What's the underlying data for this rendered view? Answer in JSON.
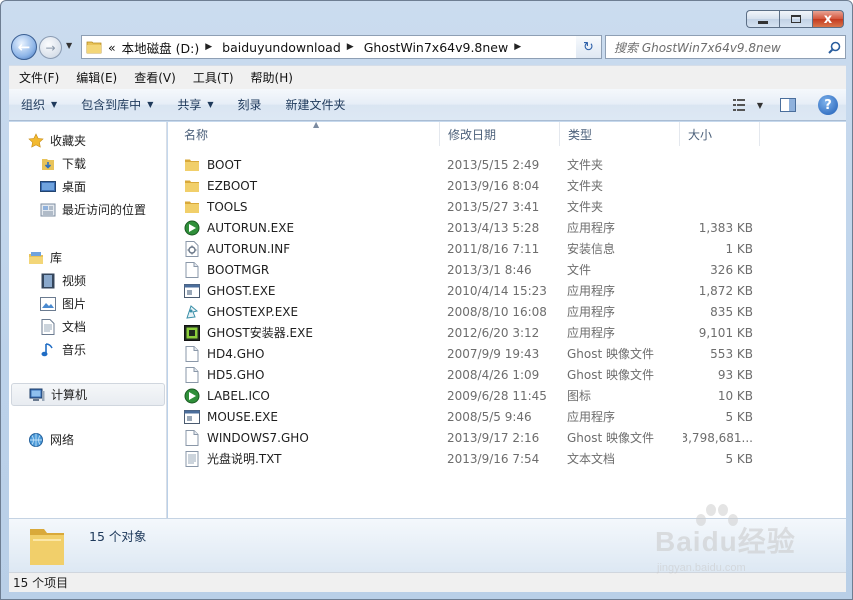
{
  "window": {
    "minimize_label": "",
    "maximize_label": "",
    "close_label": "x"
  },
  "nav": {
    "breadcrumbs": [
      "本地磁盘 (D:)",
      "baiduyundownload",
      "GhostWin7x64v9.8new"
    ],
    "overflow": "«",
    "search_placeholder": "搜索 GhostWin7x64v9.8new"
  },
  "menubar": [
    "文件(F)",
    "编辑(E)",
    "查看(V)",
    "工具(T)",
    "帮助(H)"
  ],
  "commands": [
    {
      "label": "组织",
      "dropdown": true
    },
    {
      "label": "包含到库中",
      "dropdown": true
    },
    {
      "label": "共享",
      "dropdown": true
    },
    {
      "label": "刻录",
      "dropdown": false
    },
    {
      "label": "新建文件夹",
      "dropdown": false
    }
  ],
  "sidebar": {
    "favorites": {
      "label": "收藏夹",
      "items": [
        "下载",
        "桌面",
        "最近访问的位置"
      ]
    },
    "libraries": {
      "label": "库",
      "items": [
        "视频",
        "图片",
        "文档",
        "音乐"
      ]
    },
    "computer": "计算机",
    "network": "网络"
  },
  "columns": {
    "name": "名称",
    "date": "修改日期",
    "type": "类型",
    "size": "大小"
  },
  "files": [
    {
      "name": "BOOT",
      "date": "2013/5/15 2:49",
      "type": "文件夹",
      "size": "",
      "icon": "folder-icon"
    },
    {
      "name": "EZBOOT",
      "date": "2013/9/16 8:04",
      "type": "文件夹",
      "size": "",
      "icon": "folder-icon"
    },
    {
      "name": "TOOLS",
      "date": "2013/5/27 3:41",
      "type": "文件夹",
      "size": "",
      "icon": "folder-icon"
    },
    {
      "name": "AUTORUN.EXE",
      "date": "2013/4/13 5:28",
      "type": "应用程序",
      "size": "1,383 KB",
      "icon": "autorun-exe-icon"
    },
    {
      "name": "AUTORUN.INF",
      "date": "2011/8/16 7:11",
      "type": "安装信息",
      "size": "1 KB",
      "icon": "setup-info-icon"
    },
    {
      "name": "BOOTMGR",
      "date": "2013/3/1 8:46",
      "type": "文件",
      "size": "326 KB",
      "icon": "blank-file-icon"
    },
    {
      "name": "GHOST.EXE",
      "date": "2010/4/14 15:23",
      "type": "应用程序",
      "size": "1,872 KB",
      "icon": "app-window-icon"
    },
    {
      "name": "GHOSTEXP.EXE",
      "date": "2008/8/10 16:08",
      "type": "应用程序",
      "size": "835 KB",
      "icon": "ghost-explorer-icon"
    },
    {
      "name": "GHOST安装器.EXE",
      "date": "2012/6/20 3:12",
      "type": "应用程序",
      "size": "9,101 KB",
      "icon": "installer-icon"
    },
    {
      "name": "HD4.GHO",
      "date": "2007/9/9 19:43",
      "type": "Ghost 映像文件",
      "size": "553 KB",
      "icon": "blank-file-icon"
    },
    {
      "name": "HD5.GHO",
      "date": "2008/4/26 1:09",
      "type": "Ghost 映像文件",
      "size": "93 KB",
      "icon": "blank-file-icon"
    },
    {
      "name": "LABEL.ICO",
      "date": "2009/6/28 11:45",
      "type": "图标",
      "size": "10 KB",
      "icon": "label-ico-icon"
    },
    {
      "name": "MOUSE.EXE",
      "date": "2008/5/5 9:46",
      "type": "应用程序",
      "size": "5 KB",
      "icon": "app-window-icon"
    },
    {
      "name": "WINDOWS7.GHO",
      "date": "2013/9/17 2:16",
      "type": "Ghost 映像文件",
      "size": "3,798,681...",
      "icon": "blank-file-icon"
    },
    {
      "name": "光盘说明.TXT",
      "date": "2013/9/16 7:54",
      "type": "文本文档",
      "size": "5 KB",
      "icon": "text-file-icon"
    }
  ],
  "details": {
    "count_text": "15 个对象"
  },
  "status": {
    "text": "15 个项目"
  },
  "watermark": {
    "text": "Baidu经验",
    "sub": "jingyan.baidu.com"
  }
}
